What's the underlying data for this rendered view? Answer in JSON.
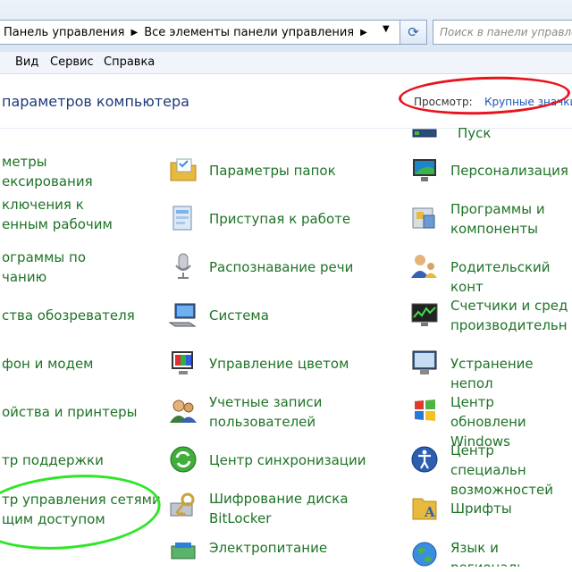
{
  "address_bar": {
    "breadcrumbs": [
      "Панель управления",
      "Все элементы панели управления"
    ],
    "search_placeholder": "Поиск в панели управлен"
  },
  "menu": {
    "items": [
      {
        "label": "Вид"
      },
      {
        "label": "Сервис"
      },
      {
        "label": "Справка"
      }
    ]
  },
  "header": {
    "title": "параметров компьютера",
    "view_label": "Просмотр:",
    "view_value": "Крупные значки"
  },
  "columns": {
    "col1": [
      "метры",
      "ексирования",
      "ключения к",
      "енным рабочим",
      "ограммы по",
      "чанию",
      "ства обозревателя",
      "фон и модем",
      "ойства и принтеры",
      "тр поддержки",
      "тр управления сетями",
      "щим доступом"
    ],
    "col2": [
      "Параметры папок",
      "Приступая к работе",
      "Распознавание речи",
      "Система",
      "Управление цветом",
      "Учетные записи\nпользователей",
      "Центр синхронизации",
      "Шифрование диска\nBitLocker",
      "Электропитание"
    ],
    "col3": [
      "Пуск",
      "Персонализация",
      "Программы и\nкомпоненты",
      "Родительский конт",
      "Счетчики и сред\nпроизводительн",
      "Устранение непол",
      "Центр обновлени\nWindows",
      "Центр специальн\nвозможностей",
      "Шрифты",
      "Язык и региональ"
    ]
  },
  "colors": {
    "link_green": "#1e7326",
    "title_blue": "#1e3a78",
    "annotation_red": "#e8131b",
    "annotation_green": "#2fe626"
  }
}
